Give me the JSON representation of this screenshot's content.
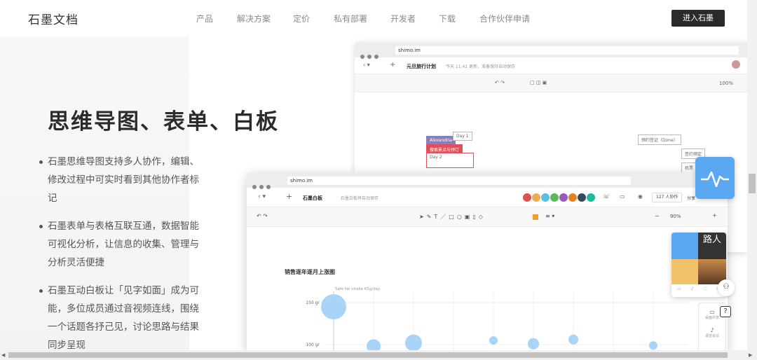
{
  "nav": {
    "logo": "石墨文档",
    "items": [
      "产品",
      "解决方案",
      "定价",
      "私有部署",
      "开发者",
      "下载",
      "合作伙伴申请"
    ],
    "enter_button": "进入石墨"
  },
  "hero": {
    "title": "思维导图、表单、白板",
    "bullets": [
      "石墨思维导图支持多人协作，编辑、修改过程中可实时看到其他协作者标记",
      "石墨表单与表格互联互通，数据智能可视化分析，让信息的收集、管理与分析灵活便捷",
      "石墨互动白板让「见字如面」成为可能，多位成员通过音视频连线，围绕一个话题各抒己见，讨论思路与结果同步呈现"
    ]
  },
  "back_window": {
    "url": "shimo.im",
    "doc_title": "元旦旅行计划",
    "status": "今天 11:41 更新，准备保持自动保存",
    "zoom": "100%",
    "nodes": {
      "a": "Alexandria",
      "b": "Day 1",
      "c": "Day 2",
      "d": "搜索景点与预订",
      "e": "预约签证（Done）",
      "f": "签约预定",
      "g": "机票"
    }
  },
  "front_window": {
    "url": "shimo.im",
    "doc_title": "石墨白板",
    "status": "石墨白板将自动保存",
    "collaborators": "127 人协作",
    "share": "分享",
    "zoom": "90%",
    "avatar_colors": [
      "#d9534f",
      "#f0ad4e",
      "#5bc0de",
      "#5cb85c",
      "#9b59b6",
      "#e67e22",
      "#34495e",
      "#1abc9c"
    ]
  },
  "chart_data": {
    "type": "scatter",
    "title": "销售逐年逐月上涨图",
    "annotation": "Safe fat intake 65g/day",
    "yticks": [
      "150 gr",
      "100 gr"
    ],
    "points": [
      {
        "x": 1,
        "y": 145,
        "r": 18
      },
      {
        "x": 2,
        "y": 98,
        "r": 10
      },
      {
        "x": 3,
        "y": 102,
        "r": 12
      },
      {
        "x": 5,
        "y": 105,
        "r": 6
      },
      {
        "x": 6,
        "y": 101,
        "r": 8
      },
      {
        "x": 7,
        "y": 106,
        "r": 7
      },
      {
        "x": 9,
        "y": 99,
        "r": 6
      }
    ]
  },
  "widgets": {
    "video_tile_text": "路人",
    "side_tool_1": "桌面共享",
    "side_tool_2": "语音会议"
  }
}
